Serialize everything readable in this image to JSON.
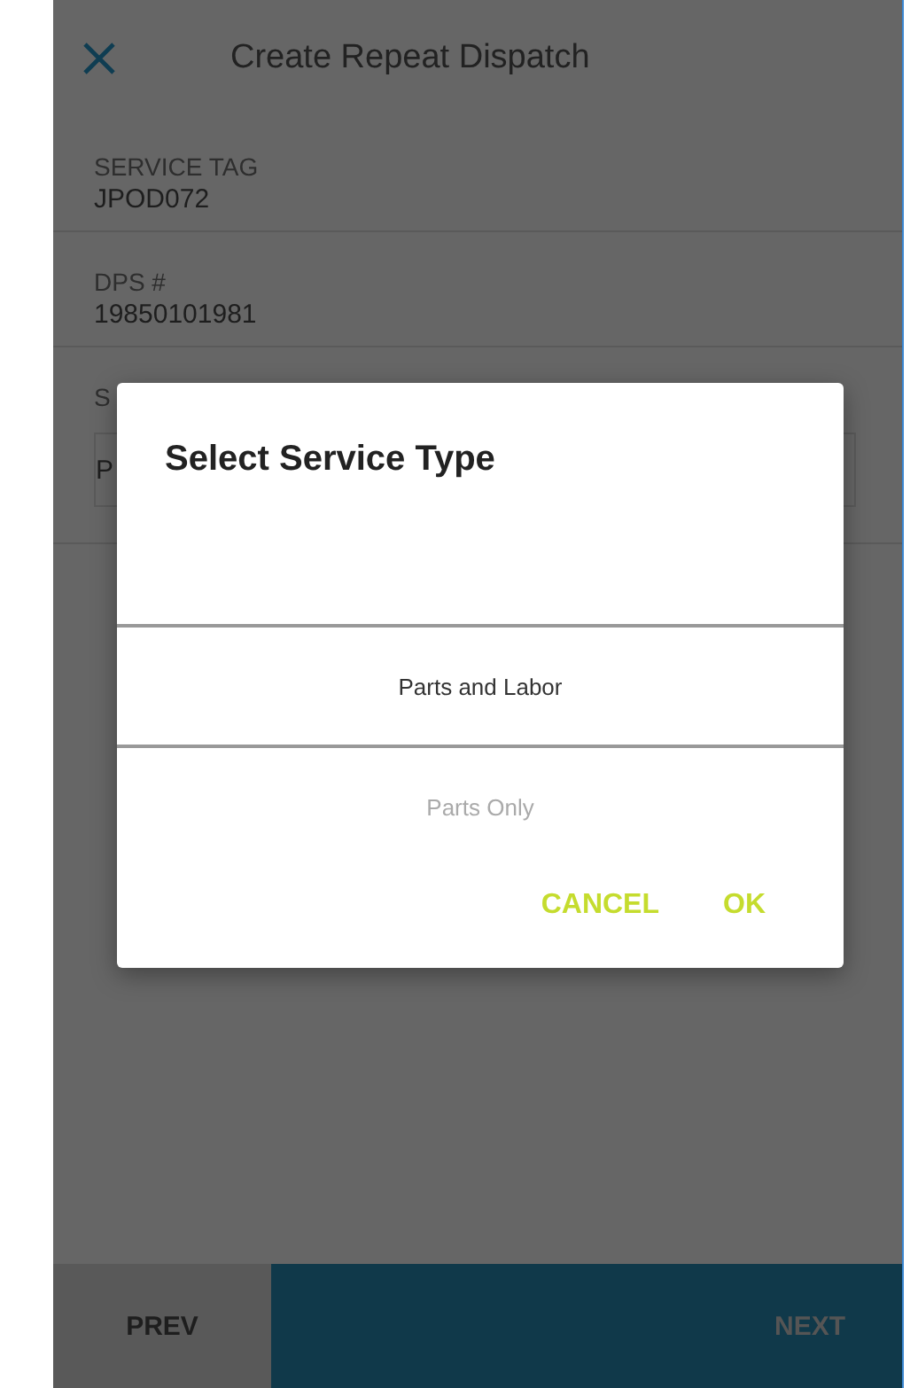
{
  "header": {
    "title": "Create Repeat Dispatch"
  },
  "fields": [
    {
      "label": "SERVICE TAG",
      "value": "JPOD072"
    },
    {
      "label": "DPS #",
      "value": "19850101981"
    }
  ],
  "partial_section": {
    "label": "S",
    "field_value": "P"
  },
  "dialog": {
    "title": "Select Service Type",
    "options": [
      {
        "label": "Parts and Labor",
        "selected": true
      },
      {
        "label": "Parts Only",
        "selected": false
      }
    ],
    "buttons": [
      "CANCEL",
      "OK"
    ]
  },
  "footer": {
    "prev": "PREV",
    "next": "NEXT",
    "next_disabled": true
  }
}
